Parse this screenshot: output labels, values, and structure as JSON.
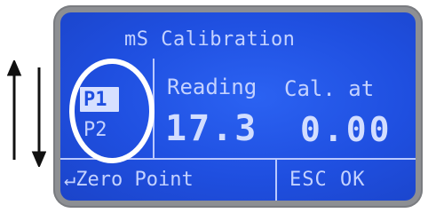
{
  "screen": {
    "title": "mS Calibration",
    "points": [
      {
        "label": "P1",
        "selected": true
      },
      {
        "label": "P2",
        "selected": false
      }
    ],
    "reading_label": "Reading",
    "calibrated_at_label": "Cal. at",
    "reading_value": "17.3",
    "calibrated_at_value": "0.00",
    "footer_left": "↵Zero Point",
    "footer_right": "ESC OK"
  },
  "icons": {
    "side_arrows": "up-down-arrows-icon",
    "highlight": "highlight-circle"
  },
  "colors": {
    "lcd_background": "#1f4fe0",
    "lcd_text": "#c9d6ff",
    "bezel": "#8d8f93",
    "highlight_circle": "#ffffff"
  }
}
